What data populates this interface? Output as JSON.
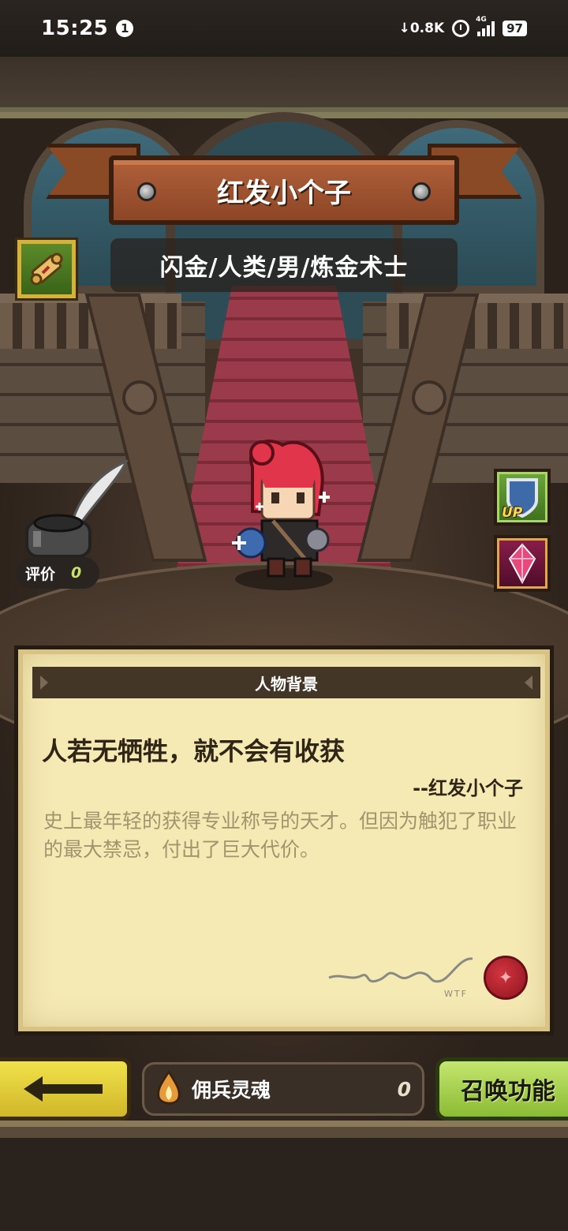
{
  "status_bar": {
    "time": "15:25",
    "notification_count": "1",
    "net_speed": "0.8K",
    "network": "4G",
    "battery": "97"
  },
  "hero": {
    "name": "红发小个子",
    "subtitle": "闪金/人类/男/炼金术士",
    "rating_label": "评价",
    "rating_value": "0"
  },
  "side_buttons": {
    "upgrade_label": "UP"
  },
  "panel": {
    "header": "人物背景",
    "quote": "人若无牺牲，就不会有收获",
    "attribution": "--红发小个子",
    "description": "史上最年轻的获得专业称号的天才。但因为触犯了职业的最大禁忌，付出了巨大代价。",
    "signature_caption": "WTF"
  },
  "bottom_bar": {
    "soul_label": "佣兵灵魂",
    "soul_count": "0",
    "summon_label": "召唤功能"
  },
  "colors": {
    "banner": "#9a5230",
    "parchment": "#f5e9b4",
    "back_button": "#e2cf3a",
    "summon_button": "#a8d052"
  }
}
